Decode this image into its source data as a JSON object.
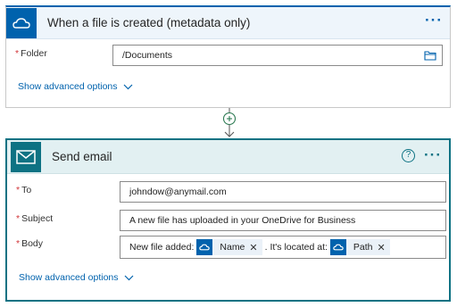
{
  "trigger": {
    "title": "When a file is created (metadata only)",
    "more": "···",
    "folder_label": "Folder",
    "folder_value": "/Documents",
    "advanced": "Show advanced options"
  },
  "action": {
    "title": "Send email",
    "help": "?",
    "more": "···",
    "to_label": "To",
    "to_value": "johndow@anymail.com",
    "subject_label": "Subject",
    "subject_value": "A new file has uploaded in your OneDrive for Business",
    "body_label": "Body",
    "body_text1": "New file added:",
    "token1": "Name",
    "body_text2": ". It's located at:",
    "token2": "Path",
    "token_close": "✕",
    "advanced": "Show advanced options"
  },
  "required_mark": "*",
  "colors": {
    "onedrive": "#0062ad",
    "outlook": "#0d7283",
    "required": "#d13438"
  }
}
